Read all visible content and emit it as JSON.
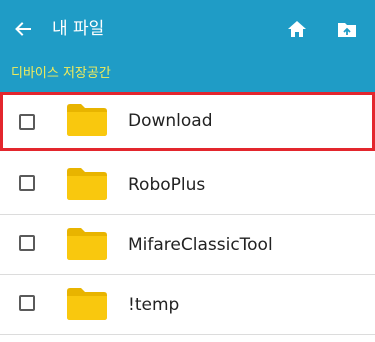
{
  "colors": {
    "app_bar": "#1f9cc6",
    "path_text": "#f2ec5a",
    "folder": "#f9c80e",
    "highlight_border": "#e3262d"
  },
  "header": {
    "back_icon": "arrow-left-icon",
    "title": "내 파일",
    "home_icon": "home-icon",
    "upload_icon": "folder-upload-icon"
  },
  "path": {
    "label": "디바이스 저장공간"
  },
  "files": [
    {
      "name": "Download",
      "type": "folder",
      "checked": false,
      "highlighted": true
    },
    {
      "name": "RoboPlus",
      "type": "folder",
      "checked": false,
      "highlighted": false
    },
    {
      "name": "MifareClassicTool",
      "type": "folder",
      "checked": false,
      "highlighted": false
    },
    {
      "name": "!temp",
      "type": "folder",
      "checked": false,
      "highlighted": false
    }
  ]
}
